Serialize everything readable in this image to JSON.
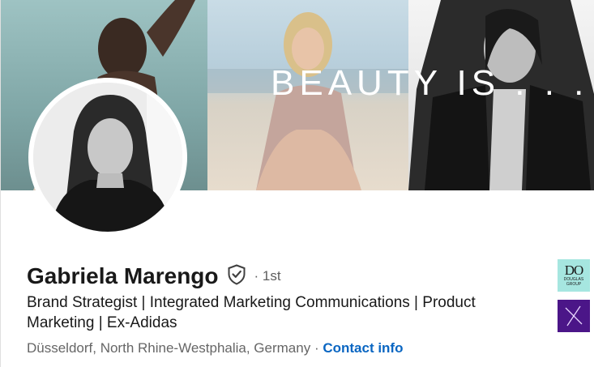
{
  "profile": {
    "name": "Gabriela Marengo",
    "connection_degree": "· 1st",
    "headline": "Brand Strategist | Integrated Marketing Communications | Product Marketing | Ex-Adidas",
    "location": "Düsseldorf, North Rhine-Westphalia, Germany",
    "location_separator": " · ",
    "contact_info_label": "Contact info"
  },
  "banner": {
    "text": "BEAUTY IS . . ."
  },
  "companies": [
    {
      "logo_line1": "DO",
      "logo_line2": "DOUGLAS GROUP",
      "color": "#a6e6e0"
    },
    {
      "color": "#4b1688"
    }
  ],
  "icons": {
    "verification": "shield-check-icon"
  }
}
